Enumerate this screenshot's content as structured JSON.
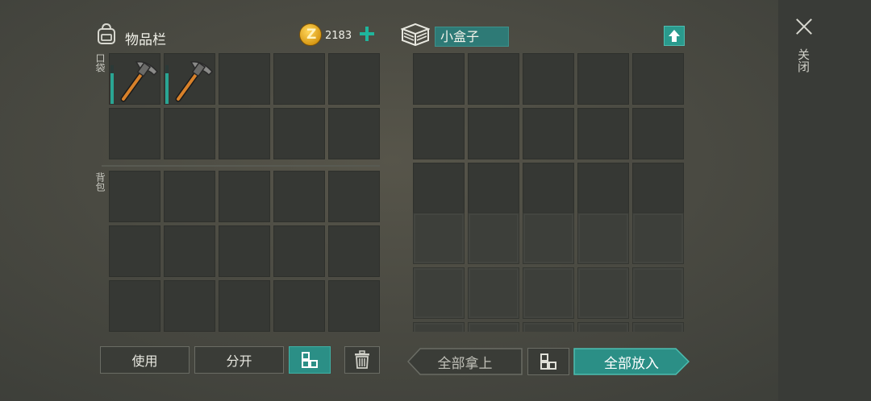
{
  "inventory": {
    "title": "物品栏",
    "pocket_label": "口袋",
    "backpack_label": "背包",
    "coins": "2183",
    "pocket_slots": [
      {
        "item": "hammer-icon",
        "durability": 0.8
      },
      {
        "item": "hammer-icon",
        "durability": 0.8
      },
      {},
      {},
      {},
      {},
      {},
      {},
      {},
      {}
    ]
  },
  "container": {
    "name": "小盒子"
  },
  "buttons": {
    "use": "使用",
    "split": "分开",
    "take_all": "全部拿上",
    "put_all": "全部放入"
  },
  "close_label": "关闭",
  "colors": {
    "accent": "#2b8f86",
    "coin": "#e0a520"
  }
}
